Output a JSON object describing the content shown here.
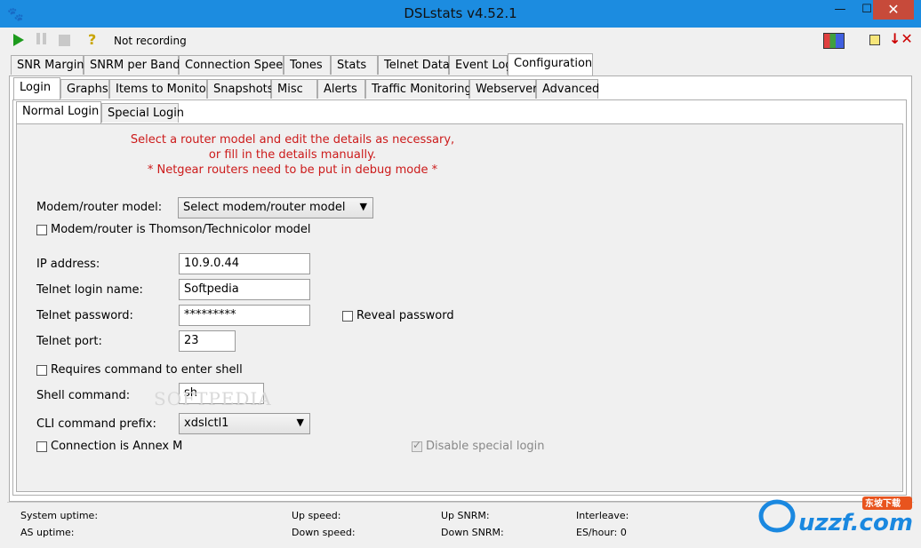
{
  "window": {
    "title": "DSLstats v4.52.1"
  },
  "toolbar": {
    "status": "Not recording"
  },
  "main_tabs": [
    "SNR Margin",
    "SNRM per Band",
    "Connection Speed",
    "Tones",
    "Stats",
    "Telnet Data",
    "Event Log",
    "Configuration"
  ],
  "config_tabs": [
    "Login",
    "Graphs",
    "Items to Monitor",
    "Snapshots",
    "Misc",
    "Alerts",
    "Traffic Monitoring",
    "Webserver",
    "Advanced"
  ],
  "login_tabs": [
    "Normal Login",
    "Special Login"
  ],
  "notice": {
    "line1": "Select a router model and edit the details as necessary,",
    "line2": "or fill in the details manually.",
    "line3": "* Netgear routers need to be put in debug mode *"
  },
  "form": {
    "model_label": "Modem/router model:",
    "model_value": "Select modem/router model",
    "thomson_label": "Modem/router is Thomson/Technicolor model",
    "ip_label": "IP address:",
    "ip_value": "10.9.0.44",
    "login_label": "Telnet login name:",
    "login_value": "Softpedia",
    "password_label": "Telnet password:",
    "password_value": "*********",
    "reveal_label": "Reveal password",
    "port_label": "Telnet port:",
    "port_value": "23",
    "requires_shell_label": "Requires command to enter shell",
    "shell_label": "Shell command:",
    "shell_value": "sh",
    "cli_label": "CLI command prefix:",
    "cli_value": "xdslctl1",
    "annex_label": "Connection is Annex M",
    "disable_special_label": "Disable special login"
  },
  "watermark": "SOFTPEDIA",
  "statusbar": {
    "system_uptime": "System uptime:",
    "as_uptime": "AS uptime:",
    "up_speed": "Up speed:",
    "down_speed": "Down speed:",
    "up_snrm": "Up SNRM:",
    "down_snrm": "Down SNRM:",
    "interleave": "Interleave:",
    "es_hour": "ES/hour: 0"
  },
  "logo": {
    "text": "uzzf.com",
    "badge": "东坡下载"
  },
  "colors": {
    "titlebar": "#1c8ce0",
    "notice": "#cc1a1a",
    "play": "#1d9b1d",
    "close": "#c74a3a"
  }
}
